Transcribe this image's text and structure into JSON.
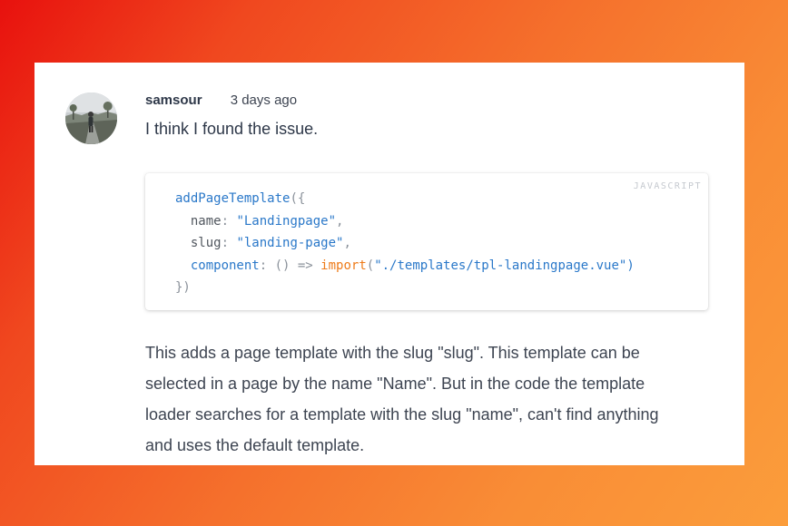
{
  "comment": {
    "author": "samsour",
    "time": "3 days ago",
    "message": "I think I found the issue.",
    "avatar_icon": "user-photo-avatar"
  },
  "code_block": {
    "language": "JAVASCRIPT",
    "lines": [
      {
        "fn": "addPageTemplate",
        "open": "({"
      },
      {
        "prop": "name",
        "sep": ": ",
        "value": "\"Landingpage\"",
        "end": ","
      },
      {
        "prop": "slug",
        "sep": ": ",
        "value": "\"landing-page\"",
        "end": ","
      },
      {
        "key": "component",
        "sep": ": ",
        "arrow": "() =>",
        "import": "import",
        "paren": "(",
        "value": "\"./templates/tpl-landingpage.vue\")"
      },
      {
        "close": "})"
      }
    ]
  },
  "body_lines": [
    "This adds a page template with the slug \"slug\". This template can be",
    "selected in a page by the name \"Name\". But in the code the template",
    "loader searches for a template with the slug \"name\", can't find anything",
    "and uses the default template."
  ],
  "colors": {
    "background_start": "#e8110e",
    "background_end": "#fb9d3b",
    "code_blue": "#2a78c9",
    "code_orange": "#ee7b19"
  }
}
